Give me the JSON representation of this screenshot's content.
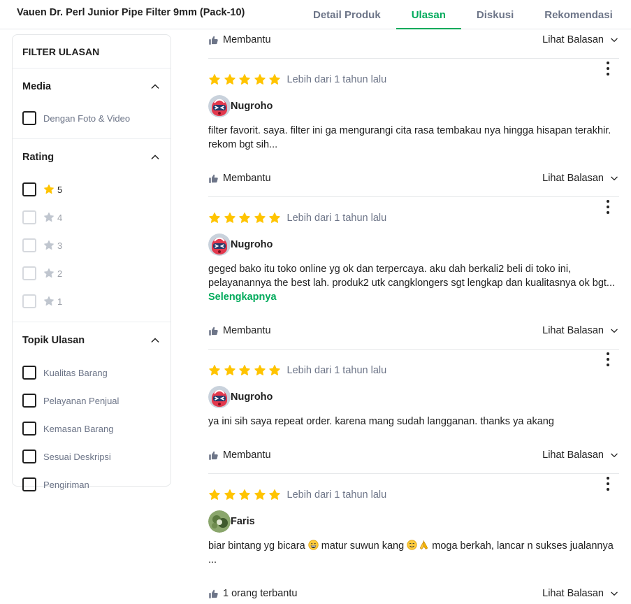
{
  "header": {
    "product_title": "Vauen Dr. Perl Junior Pipe Filter 9mm (Pack-10)",
    "tabs": [
      {
        "label": "Detail Produk"
      },
      {
        "label": "Ulasan"
      },
      {
        "label": "Diskusi"
      },
      {
        "label": "Rekomendasi"
      }
    ],
    "active_tab": "Ulasan"
  },
  "filter": {
    "title": "FILTER ULASAN",
    "media": {
      "heading": "Media",
      "options": [
        {
          "label": "Dengan Foto & Video"
        }
      ]
    },
    "rating": {
      "heading": "Rating",
      "options": [
        {
          "value": "5",
          "enabled": true
        },
        {
          "value": "4",
          "enabled": false
        },
        {
          "value": "3",
          "enabled": false
        },
        {
          "value": "2",
          "enabled": false
        },
        {
          "value": "1",
          "enabled": false
        }
      ]
    },
    "topics": {
      "heading": "Topik Ulasan",
      "options": [
        {
          "label": "Kualitas Barang"
        },
        {
          "label": "Pelayanan Penjual"
        },
        {
          "label": "Kemasan Barang"
        },
        {
          "label": "Sesuai Deskripsi"
        },
        {
          "label": "Pengiriman"
        }
      ]
    }
  },
  "top_action": {
    "helpful": "Membantu",
    "reply": "Lihat Balasan"
  },
  "reviews": [
    {
      "rating": 5,
      "time": "Lebih dari 1 tahun lalu",
      "user": "Nugroho",
      "text": "filter favorit. saya. filter ini ga mengurangi cita rasa tembakau nya hingga hisapan terakhir. rekom bgt sih...",
      "helpful": "Membantu",
      "reply": "Lihat Balasan"
    },
    {
      "rating": 5,
      "time": "Lebih dari 1 tahun lalu",
      "user": "Nugroho",
      "text": "geged bako itu toko online yg ok dan terpercaya. aku dah berkali2 beli di toko ini, pelayanannya the best lah. produk2 utk cangklongers sgt lengkap dan kualitasnya ok bgt...",
      "more": "Selengkapnya",
      "helpful": "Membantu",
      "reply": "Lihat Balasan"
    },
    {
      "rating": 5,
      "time": "Lebih dari 1 tahun lalu",
      "user": "Nugroho",
      "text": "ya ini sih saya repeat order. karena mang sudah langganan. thanks ya akang",
      "helpful": "Membantu",
      "reply": "Lihat Balasan"
    },
    {
      "rating": 5,
      "time": "Lebih dari 1 tahun lalu",
      "user": "Faris",
      "text_parts": [
        "biar bintang yg bicara ",
        " matur suwun kang ",
        " moga berkah, lancar n sukses jualannya ..."
      ],
      "emojis": [
        "grinning-face-icon",
        "smiling-face-icon",
        "folded-hands-icon"
      ],
      "helpful": "1 orang terbantu",
      "reply": "Lihat Balasan"
    }
  ],
  "colors": {
    "accent": "#00aa5b",
    "star": "#ffc400",
    "muted": "#6d7588"
  }
}
